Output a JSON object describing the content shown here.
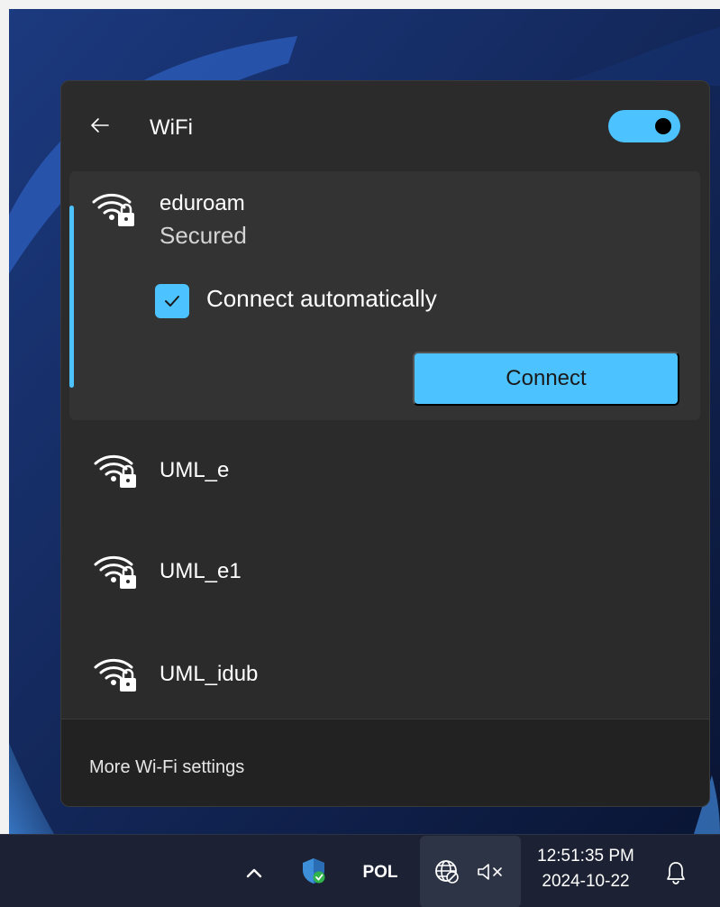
{
  "flyout": {
    "title": "WiFi",
    "back_icon": "back-arrow-icon",
    "wifi_enabled": true,
    "footer_link": "More Wi-Fi settings"
  },
  "selected_network": {
    "name": "eduroam",
    "status": "Secured",
    "icon": "wifi-secured-icon",
    "connect_automatically_label": "Connect automatically",
    "connect_automatically_checked": true,
    "connect_button_label": "Connect"
  },
  "networks": [
    {
      "name": "UML_e",
      "icon": "wifi-secured-icon"
    },
    {
      "name": "UML_e1",
      "icon": "wifi-secured-icon"
    },
    {
      "name": "UML_idub",
      "icon": "wifi-secured-icon"
    }
  ],
  "taskbar": {
    "language": "POL",
    "time": "12:51:35 PM",
    "date": "2024-10-22",
    "icons": [
      "chevron-up-icon",
      "defender-shield-icon",
      "globe-no-internet-icon",
      "speaker-muted-icon",
      "notification-bell-icon"
    ]
  },
  "colors": {
    "accent": "#4cc2ff",
    "panel": "#2b2b2b",
    "taskbar": "#1c2233"
  }
}
